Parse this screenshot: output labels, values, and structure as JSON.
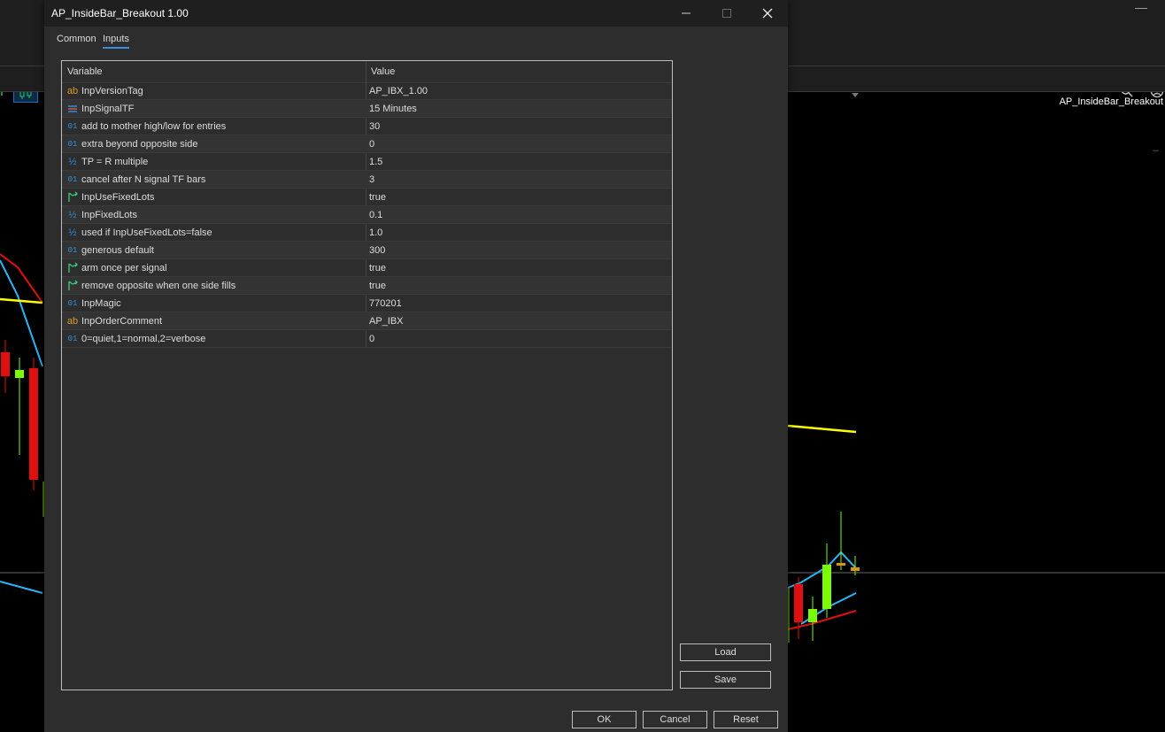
{
  "dialog": {
    "title": "AP_InsideBar_Breakout 1.00",
    "tabs": [
      "Common",
      "Inputs"
    ],
    "active_tab": "Inputs"
  },
  "grid": {
    "headers": {
      "variable": "Variable",
      "value": "Value"
    },
    "rows": [
      {
        "icon": "string-icon",
        "variable": "InpVersionTag",
        "value": "AP_IBX_1.00"
      },
      {
        "icon": "enum-icon",
        "variable": "InpSignalTF",
        "value": "15 Minutes"
      },
      {
        "icon": "integer-icon",
        "variable": "add to mother high/low for entries",
        "value": "30"
      },
      {
        "icon": "integer-icon",
        "variable": "extra beyond opposite side",
        "value": "0"
      },
      {
        "icon": "double-icon",
        "variable": "TP = R multiple",
        "value": "1.5"
      },
      {
        "icon": "integer-icon",
        "variable": "cancel after N signal TF bars",
        "value": "3"
      },
      {
        "icon": "bool-icon",
        "variable": "InpUseFixedLots",
        "value": "true"
      },
      {
        "icon": "double-icon",
        "variable": "InpFixedLots",
        "value": "0.1"
      },
      {
        "icon": "double-icon",
        "variable": "used if InpUseFixedLots=false",
        "value": "1.0"
      },
      {
        "icon": "integer-icon",
        "variable": "generous default",
        "value": "300"
      },
      {
        "icon": "bool-icon",
        "variable": "arm once per signal",
        "value": "true"
      },
      {
        "icon": "bool-icon",
        "variable": "remove opposite when one side fills",
        "value": "true"
      },
      {
        "icon": "integer-icon",
        "variable": "InpMagic",
        "value": "770201"
      },
      {
        "icon": "string-icon",
        "variable": "InpOrderComment",
        "value": "AP_IBX"
      },
      {
        "icon": "integer-icon",
        "variable": "0=quiet,1=normal,2=verbose",
        "value": "0"
      }
    ]
  },
  "icon_glyphs": {
    "string": "ab",
    "integer": "01",
    "double": "½"
  },
  "buttons": {
    "load": "Load",
    "save": "Save",
    "ok": "OK",
    "cancel": "Cancel",
    "reset": "Reset"
  },
  "background": {
    "chart_label": "AP_InsideBar_Breakout",
    "minimize_glyph": "—",
    "tab_underscore": "_"
  },
  "colors": {
    "accent": "#3b8ddd",
    "bull_candle": "#7cfc00",
    "bear_candle": "#e01010",
    "ma_yellow": "#ffff00",
    "ma_blue": "#29b6f6",
    "ma_red": "#e01010"
  }
}
